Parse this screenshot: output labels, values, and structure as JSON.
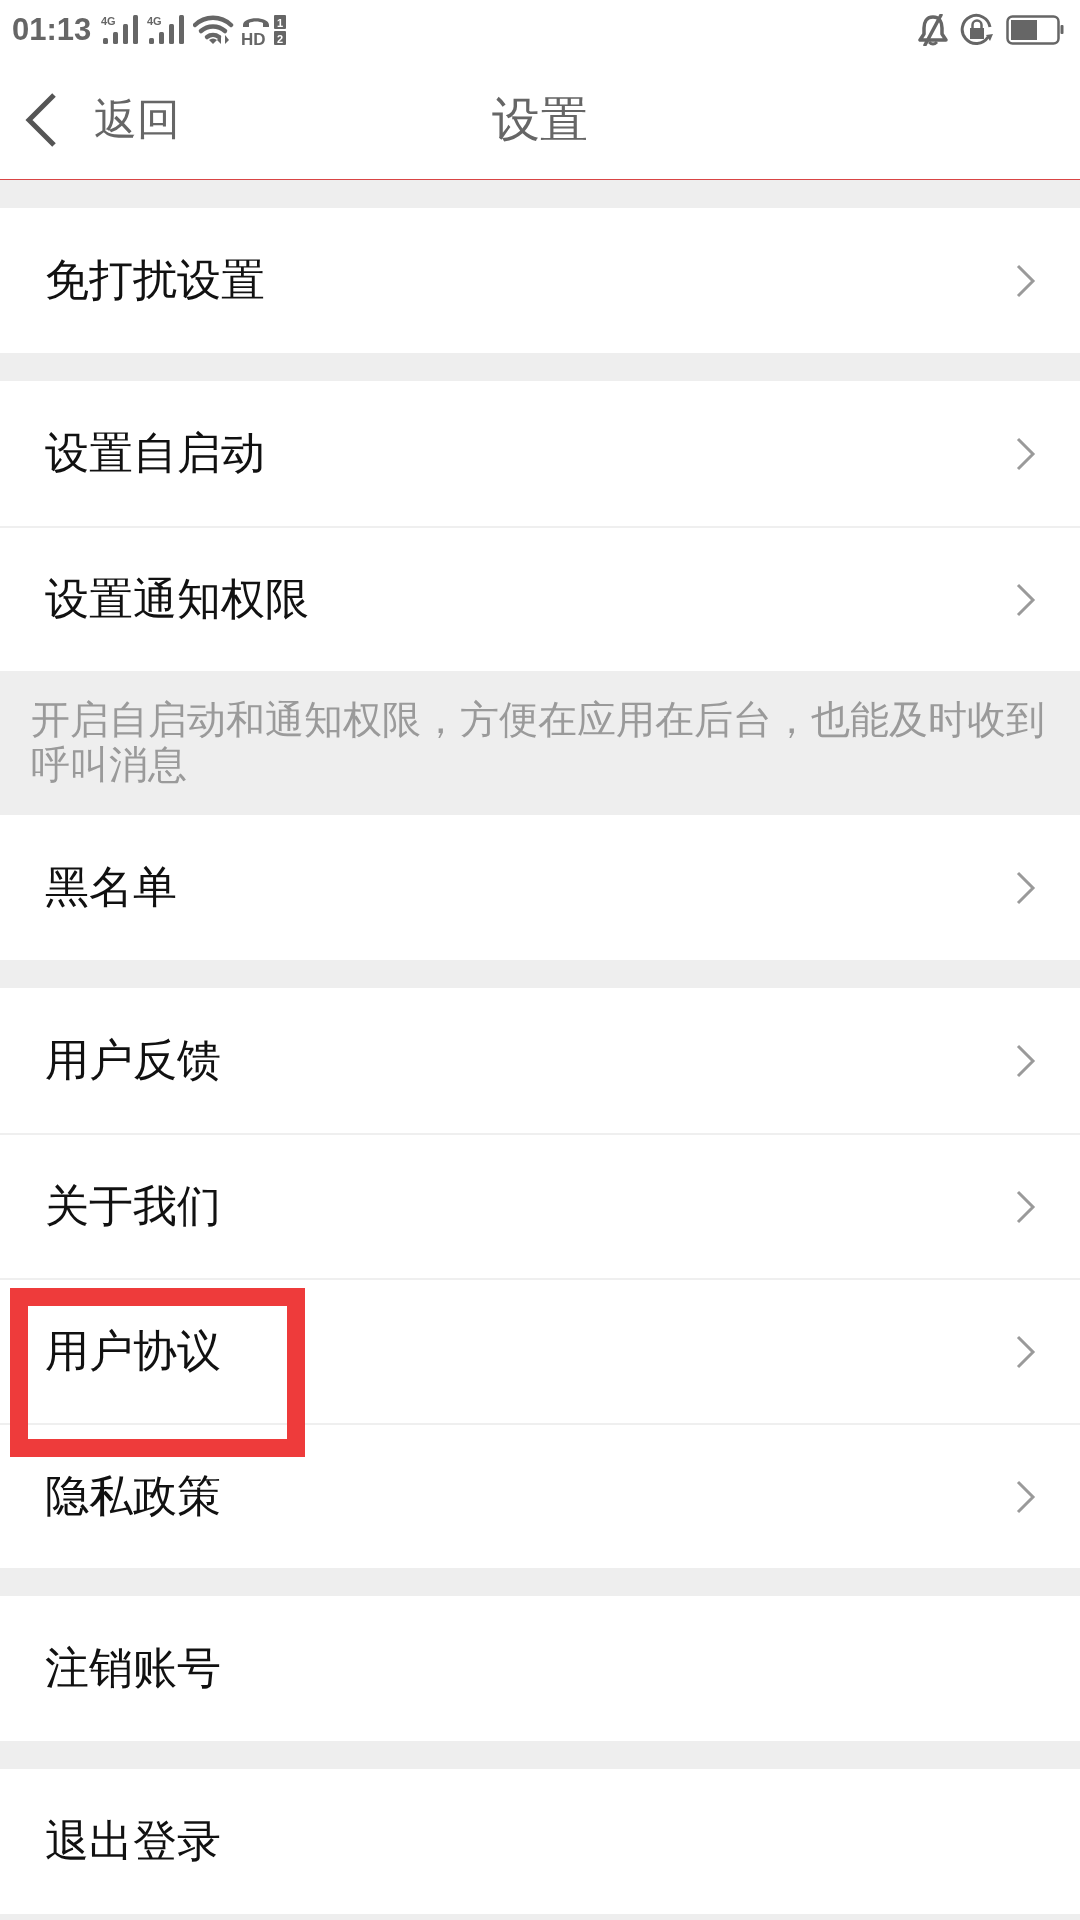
{
  "status_bar": {
    "time": "01:13",
    "signals": [
      {
        "network": "4G"
      },
      {
        "network": "4G"
      }
    ],
    "hd_call": {
      "label": "HD",
      "sims": [
        "1",
        "2"
      ]
    }
  },
  "header": {
    "back": "返回",
    "title": "设置"
  },
  "sections": [
    {
      "items": [
        {
          "label": "免打扰设置",
          "chevron": true,
          "highlighted": false
        }
      ]
    },
    {
      "items": [
        {
          "label": "设置自启动",
          "chevron": true,
          "highlighted": false
        },
        {
          "label": "设置通知权限",
          "chevron": true,
          "highlighted": false
        }
      ],
      "note": "开启自启动和通知权限，方便在应用在后台，也能及时收到呼叫消息"
    },
    {
      "items": [
        {
          "label": "黑名单",
          "chevron": true,
          "highlighted": false
        }
      ]
    },
    {
      "items": [
        {
          "label": "用户反馈",
          "chevron": true,
          "highlighted": false
        },
        {
          "label": "关于我们",
          "chevron": true,
          "highlighted": false
        },
        {
          "label": "用户协议",
          "chevron": true,
          "highlighted": true
        },
        {
          "label": "隐私政策",
          "chevron": true,
          "highlighted": false
        }
      ]
    },
    {
      "items": [
        {
          "label": "注销账号",
          "chevron": false,
          "highlighted": false
        }
      ]
    },
    {
      "items": [
        {
          "label": "退出登录",
          "chevron": false,
          "highlighted": false
        }
      ]
    }
  ]
}
